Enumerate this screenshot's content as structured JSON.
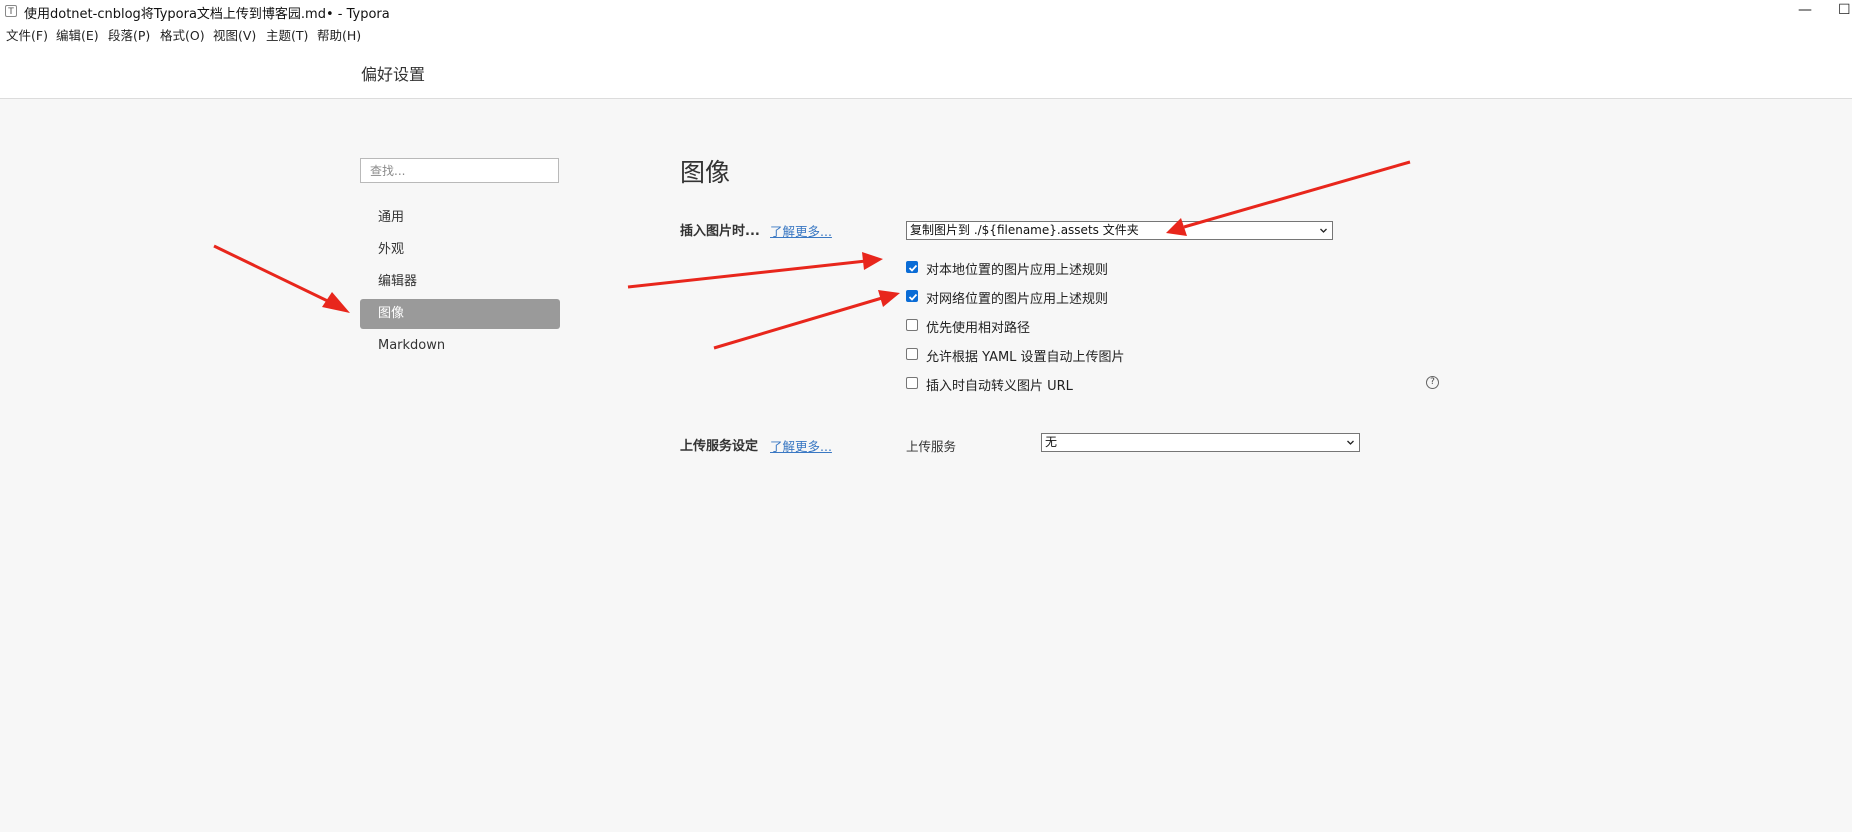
{
  "window": {
    "app_icon": "T",
    "title": "使用dotnet-cnblog将Typora文档上传到博客园.md• - Typora",
    "minimize_glyph": "—",
    "maximize_glyph": "☐"
  },
  "menubar": {
    "items": [
      "文件(F)",
      "编辑(E)",
      "段落(P)",
      "格式(O)",
      "视图(V)",
      "主题(T)",
      "帮助(H)"
    ]
  },
  "preferences": {
    "title": "偏好设置",
    "search": {
      "placeholder": "查找...",
      "value": ""
    },
    "nav": [
      {
        "label": "通用",
        "active": false
      },
      {
        "label": "外观",
        "active": false
      },
      {
        "label": "编辑器",
        "active": false
      },
      {
        "label": "图像",
        "active": true
      },
      {
        "label": "Markdown",
        "active": false
      }
    ]
  },
  "image_section": {
    "title": "图像",
    "insert_label": "插入图片时...",
    "learn_more": "了解更多...",
    "insert_select": "复制图片到 ./${filename}.assets 文件夹",
    "checkboxes": [
      {
        "label": "对本地位置的图片应用上述规则",
        "checked": true
      },
      {
        "label": "对网络位置的图片应用上述规则",
        "checked": true
      },
      {
        "label": "优先使用相对路径",
        "checked": false
      },
      {
        "label": "允许根据 YAML 设置自动上传图片",
        "checked": false
      },
      {
        "label": "插入时自动转义图片 URL",
        "checked": false
      }
    ],
    "help_glyph": "?"
  },
  "upload_section": {
    "label": "上传服务设定",
    "learn_more": "了解更多...",
    "service_label": "上传服务",
    "service_select": "无"
  },
  "colors": {
    "annotation_arrow": "#e8261c",
    "active_nav": "#9a9a9a",
    "checkbox_checked": "#0a6cd6",
    "link": "#3a78c3"
  }
}
